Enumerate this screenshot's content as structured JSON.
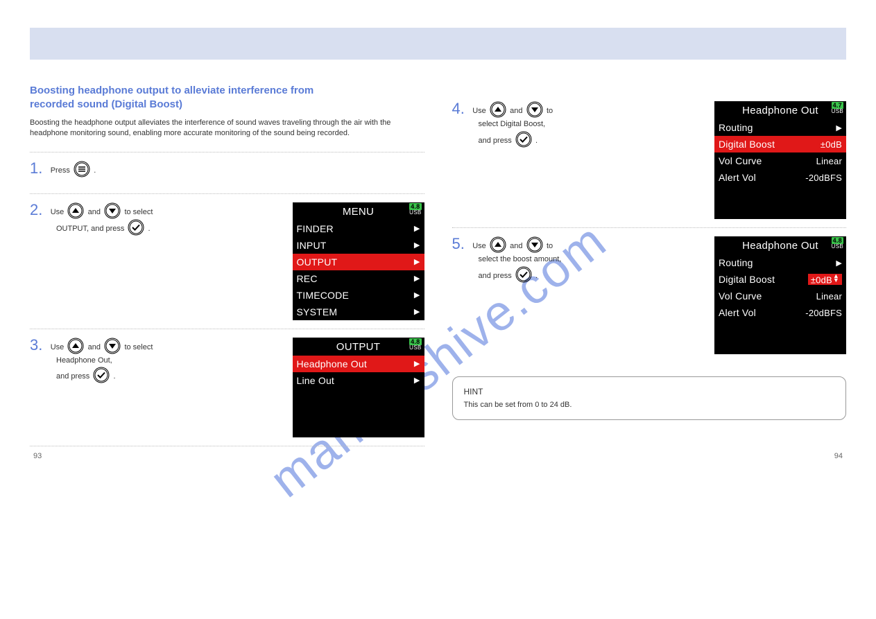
{
  "watermark": "manualshive.com",
  "page_numbers": {
    "left": "93",
    "right": "94"
  },
  "left": {
    "title_line1": "Boosting headphone output to alleviate interference from ",
    "title_line2": "recorded sound (Digital Boost)",
    "desc": "Boosting the headphone output alleviates the interference of sound waves traveling through the air with the headphone monitoring sound, enabling more accurate monitoring of the sound being recorded.",
    "step1": "Press ",
    "step1_b": ".",
    "step2a": "Use ",
    "step2b": " and ",
    "step2c": " to select ",
    "step2d": "OUTPUT, and press ",
    "step2e": ".",
    "step3a": "Use ",
    "step3b": " and ",
    "step3c": " to select ",
    "step3d": "Headphone Out, ",
    "step3e": "and press ",
    "step3f": "."
  },
  "right": {
    "step4a": "Use ",
    "step4b": " and ",
    "step4c": " to ",
    "step4d": "select Digital Boost, ",
    "step4e": "and press ",
    "step4f": ".",
    "step5a": "Use ",
    "step5b": " and ",
    "step5c": " to ",
    "step5d": "select the boost amount, ",
    "step5e": "and press ",
    "step5f": ".",
    "hint_title": "HINT",
    "hint_body": "This can be set from 0 to 24 dB."
  },
  "screen_menu": {
    "title": "MENU",
    "bat": "4.8",
    "items": [
      "FINDER",
      "INPUT",
      "OUTPUT",
      "REC",
      "TIMECODE",
      "SYSTEM"
    ],
    "selected": 2
  },
  "screen_output": {
    "title": "OUTPUT",
    "bat": "4.8",
    "items": [
      "Headphone Out",
      "Line Out"
    ],
    "selected": 0
  },
  "screen_hp_a": {
    "title": "Headphone Out",
    "bat": "4.7",
    "rows": [
      {
        "label": "Routing",
        "val": "",
        "arrow": true,
        "selected": false
      },
      {
        "label": "Digital Boost",
        "val": "±0dB",
        "arrow": false,
        "selected": true
      },
      {
        "label": "Vol Curve",
        "val": "Linear",
        "arrow": false,
        "selected": false
      },
      {
        "label": "Alert Vol",
        "val": "-20dBFS",
        "arrow": false,
        "selected": false
      }
    ]
  },
  "screen_hp_b": {
    "title": "Headphone Out",
    "bat": "4.8",
    "rows": [
      {
        "label": "Routing",
        "val": "",
        "arrow": true,
        "selected": false,
        "valbox": false
      },
      {
        "label": "Digital Boost",
        "val": "±0dB",
        "arrow": false,
        "selected": false,
        "valbox": true
      },
      {
        "label": "Vol Curve",
        "val": "Linear",
        "arrow": false,
        "selected": false,
        "valbox": false
      },
      {
        "label": "Alert Vol",
        "val": "-20dBFS",
        "arrow": false,
        "selected": false,
        "valbox": false
      }
    ]
  },
  "usb_label": "USB"
}
